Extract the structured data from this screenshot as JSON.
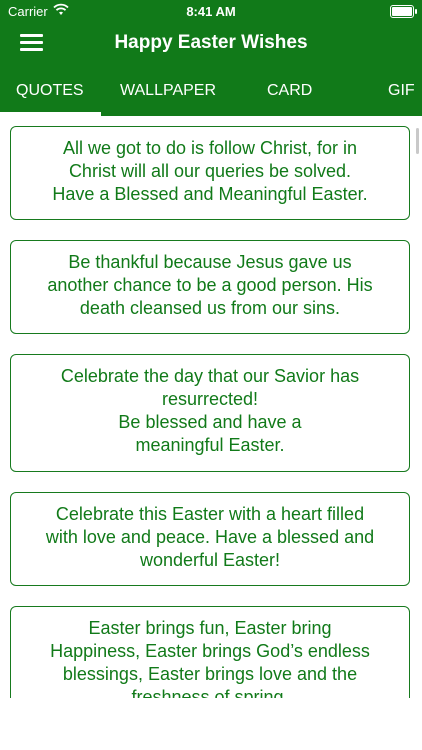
{
  "status_bar": {
    "carrier": "Carrier",
    "time": "8:41 AM"
  },
  "nav": {
    "title": "Happy Easter Wishes"
  },
  "tabs": [
    {
      "label": "QUOTES"
    },
    {
      "label": "WALLPAPER"
    },
    {
      "label": "CARD"
    },
    {
      "label": "GIF"
    }
  ],
  "quotes": [
    {
      "lines": [
        "All we got to do is follow Christ, for in",
        "Christ will all our queries be solved.",
        "Have a Blessed and Meaningful Easter."
      ]
    },
    {
      "lines": [
        "Be thankful because Jesus gave us",
        "another chance to be a good person. His",
        "death cleansed us from our sins."
      ]
    },
    {
      "lines": [
        "Celebrate the day that our Savior has",
        "resurrected!",
        "Be blessed and have a",
        "meaningful Easter."
      ]
    },
    {
      "lines": [
        "Celebrate this Easter with a heart filled",
        "with love and peace. Have a blessed and",
        "wonderful Easter!"
      ]
    },
    {
      "lines": [
        "Easter brings fun, Easter bring",
        "Happiness, Easter brings God’s endless",
        "blessings, Easter brings love and the",
        "freshness of spring."
      ]
    }
  ],
  "colors": {
    "brand_green": "#117a19",
    "card_border": "#177a1e"
  }
}
